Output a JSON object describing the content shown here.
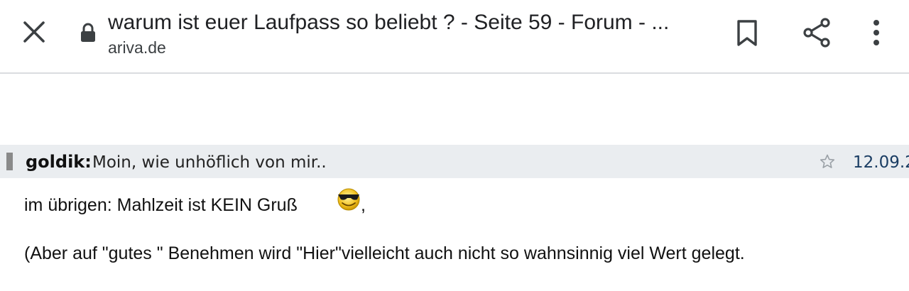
{
  "browser": {
    "close_icon": "close-icon",
    "lock_icon": "lock-icon",
    "page_title": "warum ist euer Laufpass so beliebt ? - Seite 59 - Forum - ...",
    "domain": "ariva.de",
    "bookmark_icon": "bookmark-icon",
    "share_icon": "share-icon",
    "more_icon": "more-vert-icon"
  },
  "post": {
    "author": "goldik:",
    "title": "Moin, wie unhöflich von mir..",
    "star_icon": "star-outline-icon",
    "date": "12.09.2",
    "line1_text": "im übrigen: Mahlzeit ist KEIN Gruß",
    "line1_icon": "cool-smiley-icon",
    "line1_suffix": ",",
    "line2_text": "(Aber auf \"gutes \" Benehmen wird \"Hier\"vielleicht auch nicht so wahnsinnig viel Wert gelegt."
  },
  "colors": {
    "toolbar_bg": "#ffffff",
    "post_header_bg": "#eaedf0",
    "date_color": "#1a3d63",
    "marker_color": "#8a8a8a"
  }
}
